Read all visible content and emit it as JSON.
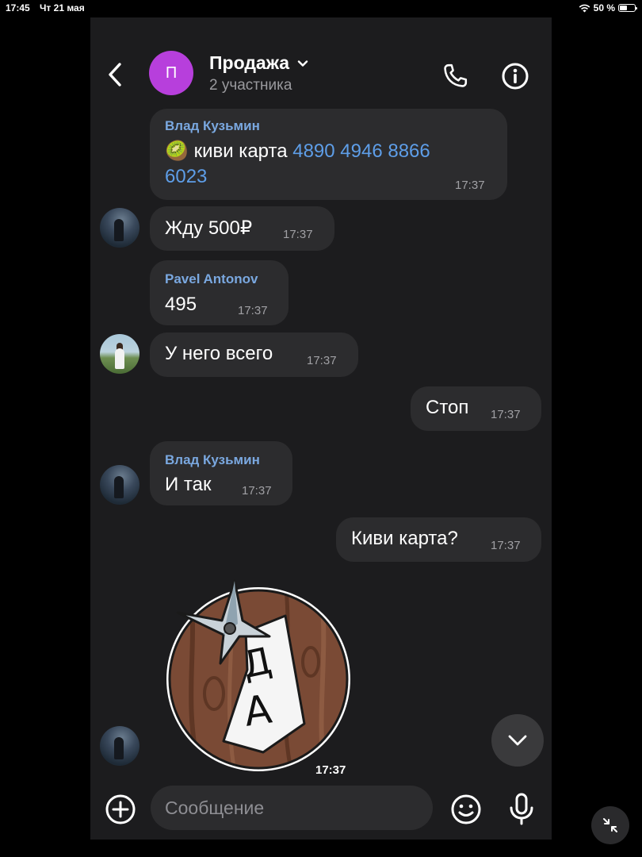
{
  "status_bar": {
    "time": "17:45",
    "date": "Чт 21 мая",
    "battery": "50 %",
    "battery_level": 0.5
  },
  "header": {
    "avatar_letter": "П",
    "title": "Продажа",
    "subtitle": "2 участника"
  },
  "messages": [
    {
      "sender": "Влад Кузьмин",
      "emoji": "🥝",
      "text": "киви  карта ",
      "link_line1": "4890 4946 8866",
      "link_line2": "6023",
      "time": "17:37"
    },
    {
      "text": "Жду 500₽",
      "time": "17:37"
    },
    {
      "sender": "Pavel Antonov",
      "text": "495",
      "time": "17:37"
    },
    {
      "text": "У него всего",
      "time": "17:37"
    },
    {
      "text": "Стоп",
      "time": "17:37"
    },
    {
      "sender": "Влад Кузьмин",
      "text": "И так",
      "time": "17:37"
    },
    {
      "text": "Киви карта?",
      "time": "17:37"
    }
  ],
  "sticker": {
    "letter1": "Д",
    "letter2": "А",
    "time": "17:37"
  },
  "composer": {
    "placeholder": "Сообщение"
  },
  "colors": {
    "background": "#1c1c1e",
    "bubble": "#2c2c2e",
    "accent_link": "#5e9ee8",
    "sender_name": "#7aa8e0",
    "group_avatar": "#b73fdc"
  }
}
